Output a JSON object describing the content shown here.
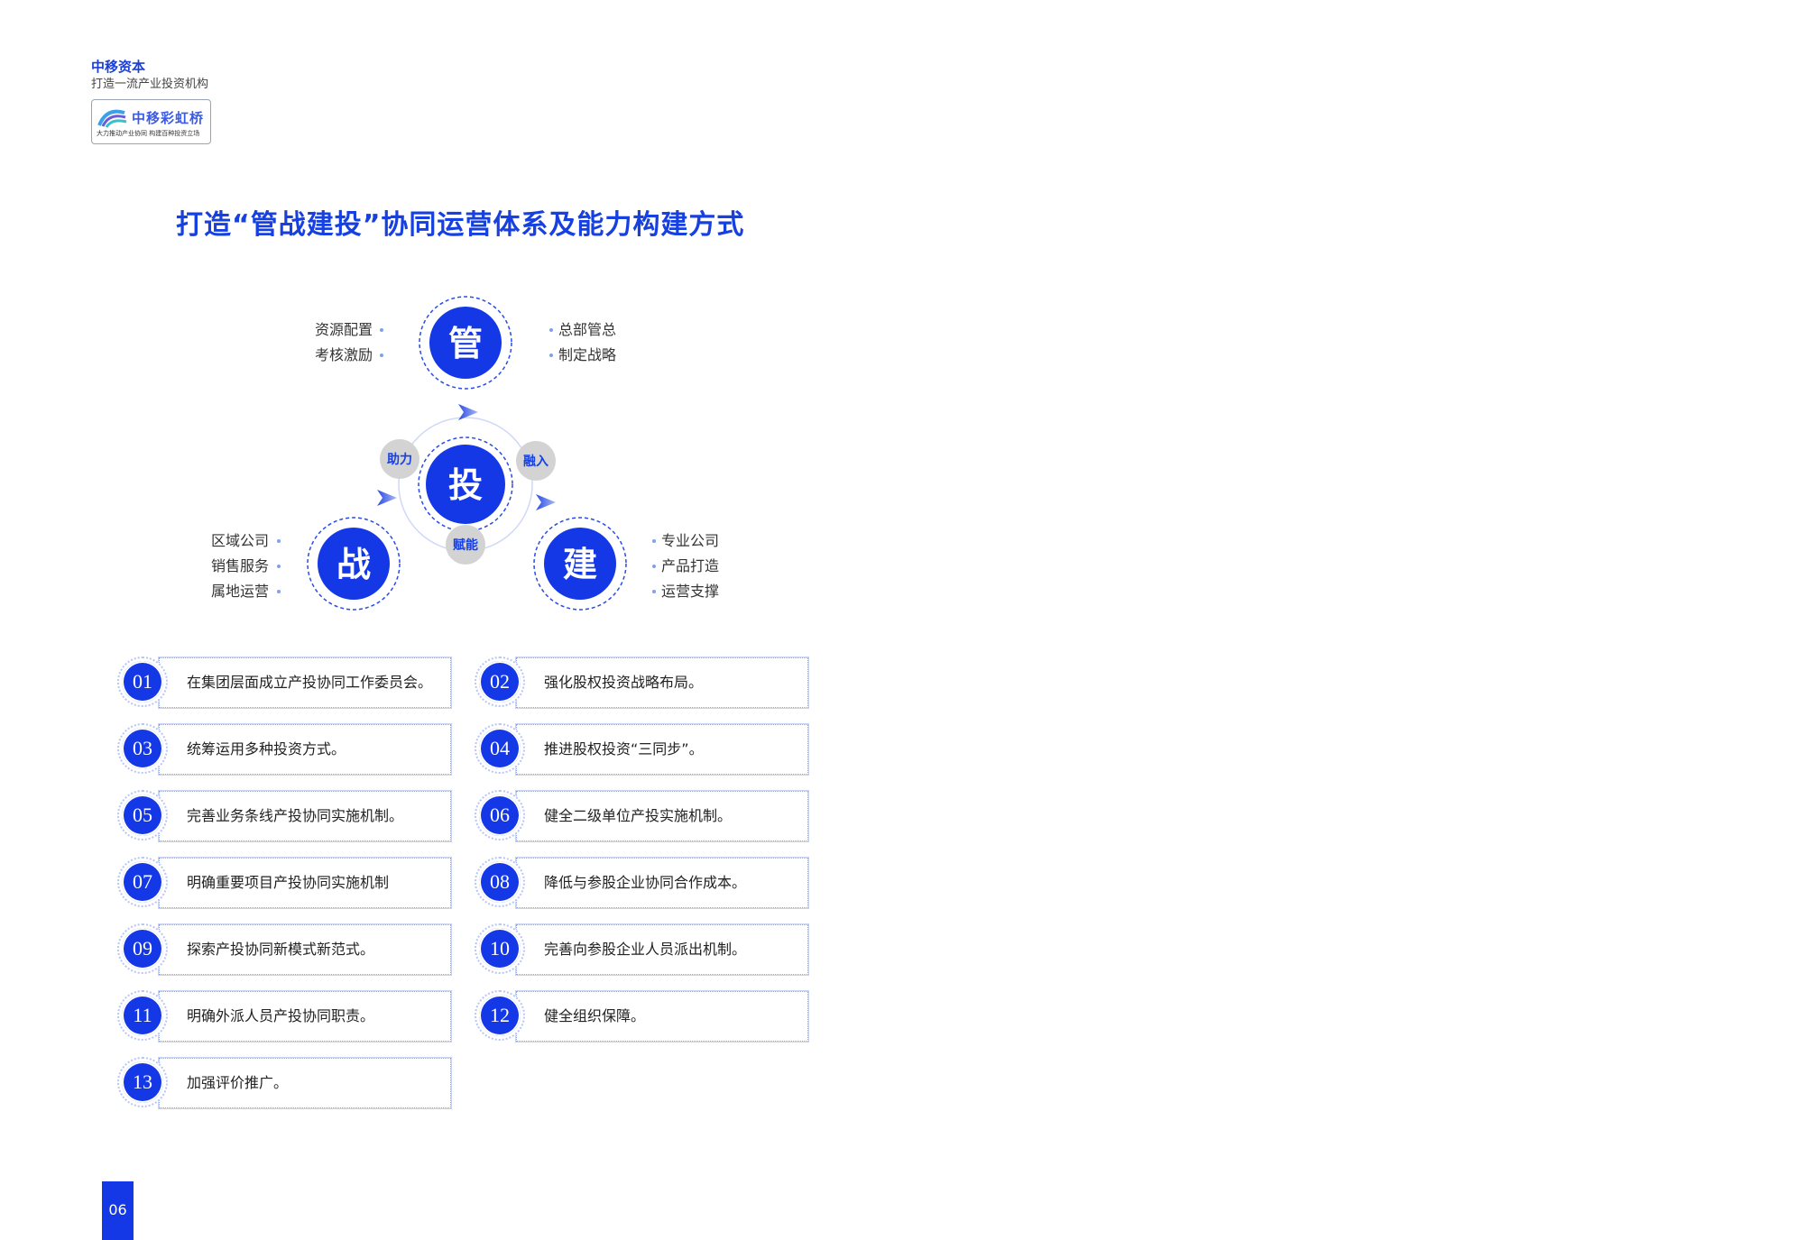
{
  "brand": {
    "name": "中移资本",
    "slogan": "打造一流产业投资机构",
    "logo_title": "中移彩虹桥",
    "logo_subtitle": "大力推动产业协同 构建百种投资立场"
  },
  "title": "打造“管战建投”协同运营体系及能力构建方式",
  "diagram": {
    "top": {
      "char": "管",
      "left_items": [
        "资源配置",
        "考核激励"
      ],
      "right_items": [
        "总部管总",
        "制定战略"
      ]
    },
    "center": {
      "char": "投"
    },
    "bottom_left": {
      "char": "战",
      "items": [
        "区域公司",
        "销售服务",
        "属地运营"
      ]
    },
    "bottom_right": {
      "char": "建",
      "items": [
        "专业公司",
        "产品打造",
        "运营支撑"
      ]
    },
    "links": {
      "left": "助力",
      "right": "融入",
      "bottom": "赋能"
    }
  },
  "items": [
    {
      "num": "01",
      "text": "在集团层面成立产投协同工作委员会。"
    },
    {
      "num": "02",
      "text": "强化股权投资战略布局。"
    },
    {
      "num": "03",
      "text": "统筹运用多种投资方式。"
    },
    {
      "num": "04",
      "text": "推进股权投资“三同步”。"
    },
    {
      "num": "05",
      "text": "完善业务条线产投协同实施机制。"
    },
    {
      "num": "06",
      "text": "健全二级单位产投实施机制。"
    },
    {
      "num": "07",
      "text": "明确重要项目产投协同实施机制"
    },
    {
      "num": "08",
      "text": "降低与参股企业协同合作成本。"
    },
    {
      "num": "09",
      "text": "探索产投协同新模式新范式。"
    },
    {
      "num": "10",
      "text": "完善向参股企业人员派出机制。"
    },
    {
      "num": "11",
      "text": "明确外派人员产投协同职责。"
    },
    {
      "num": "12",
      "text": "健全组织保障。"
    },
    {
      "num": "13",
      "text": "加强评价推广。"
    }
  ],
  "page_number": "06",
  "colors": {
    "primary": "#1438e6",
    "title": "#1740e0",
    "grey_node": "#d3d3d3"
  }
}
